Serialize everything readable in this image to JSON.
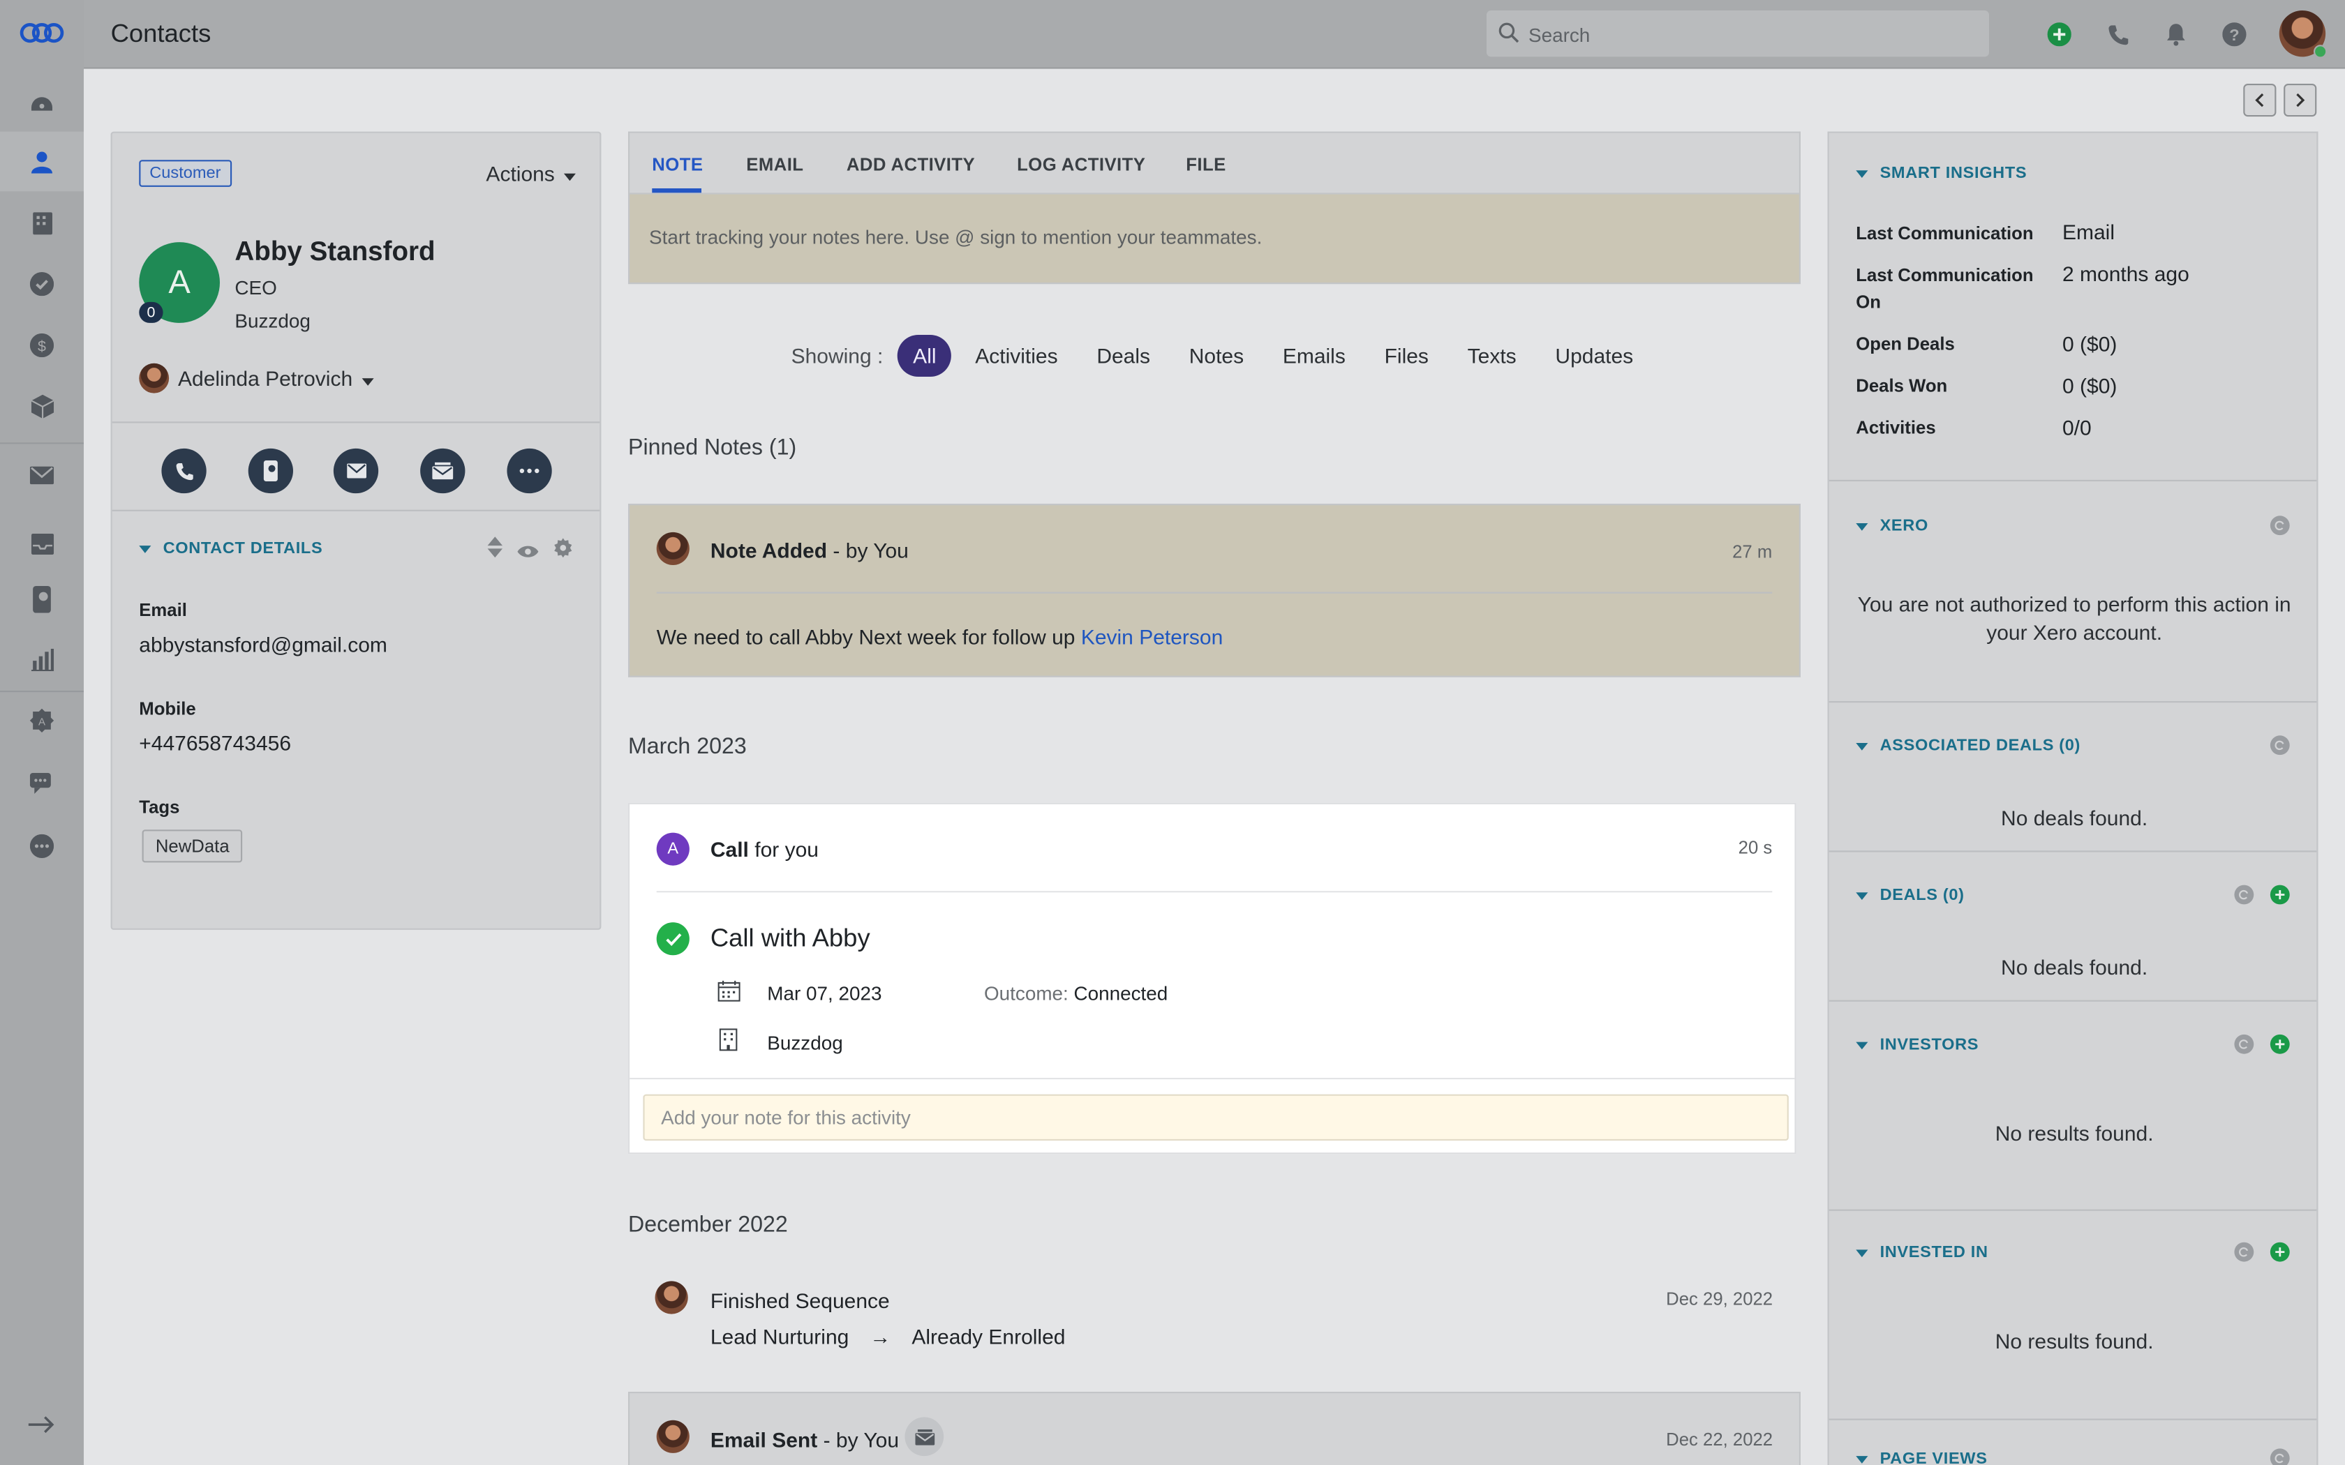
{
  "header": {
    "title": "Contacts",
    "search_placeholder": "Search"
  },
  "contact": {
    "badge": "Customer",
    "actions_label": "Actions",
    "avatar_letter": "A",
    "avatar_count": "0",
    "name": "Abby Stansford",
    "role": "CEO",
    "company": "Buzzdog",
    "owner": "Adelinda Petrovich"
  },
  "contact_details": {
    "title": "CONTACT DETAILS",
    "email_label": "Email",
    "email": "abbystansford@gmail.com",
    "mobile_label": "Mobile",
    "mobile": "+447658743456",
    "tags_label": "Tags",
    "tag": "NewData"
  },
  "composer": {
    "tabs": [
      "NOTE",
      "EMAIL",
      "ADD ACTIVITY",
      "LOG ACTIVITY",
      "FILE"
    ],
    "placeholder": "Start tracking your notes here. Use @ sign to mention your teammates."
  },
  "filters": {
    "label": "Showing :",
    "items": [
      "All",
      "Activities",
      "Deals",
      "Notes",
      "Emails",
      "Files",
      "Texts",
      "Updates"
    ]
  },
  "timeline": {
    "pinned_heading": "Pinned Notes (1)",
    "pinned": {
      "title": "Note Added",
      "by": " - by You",
      "time": "27 m",
      "text": "We need to call Abby Next week for follow up ",
      "mention": "Kevin Peterson"
    },
    "march_heading": "March 2023",
    "call": {
      "avatar_letter": "A",
      "title": "Call",
      "suffix": " for you",
      "time": "20 s",
      "subject": "Call with Abby",
      "date": "Mar 07, 2023",
      "outcome_label": "Outcome:",
      "outcome": "Connected",
      "company": "Buzzdog",
      "note_placeholder": "Add your note for this activity"
    },
    "december_heading": "December 2022",
    "sequence": {
      "title": "Finished Sequence",
      "time": "Dec 29, 2022",
      "from": "Lead Nurturing",
      "arrow": "→",
      "to": "Already Enrolled"
    },
    "email": {
      "title": "Email Sent",
      "by": " - by You",
      "time": "Dec 22, 2022"
    }
  },
  "insights": {
    "title": "SMART INSIGHTS",
    "rows": [
      {
        "label": "Last Communication",
        "value": "Email"
      },
      {
        "label": "Last Communication On",
        "value": "2 months ago"
      },
      {
        "label": "Open Deals",
        "value": "0 ($0)"
      },
      {
        "label": "Deals Won",
        "value": "0 ($0)"
      },
      {
        "label": "Activities",
        "value": "0/0"
      }
    ]
  },
  "xero": {
    "title": "XERO",
    "message": "You are not authorized to perform this action in your Xero account."
  },
  "associated_deals": {
    "title": "ASSOCIATED DEALS (0)",
    "message": "No deals found."
  },
  "deals": {
    "title": "DEALS (0)",
    "message": "No deals found."
  },
  "investors": {
    "title": "INVESTORS",
    "message": "No results found."
  },
  "invested_in": {
    "title": "INVESTED IN",
    "message": "No results found."
  },
  "page_views": {
    "title": "PAGE VIEWS"
  },
  "colors": {
    "accent": "#2456c4",
    "pill": "#3a2f78",
    "success": "#23b04a",
    "avatar_green": "#1f8a55"
  }
}
